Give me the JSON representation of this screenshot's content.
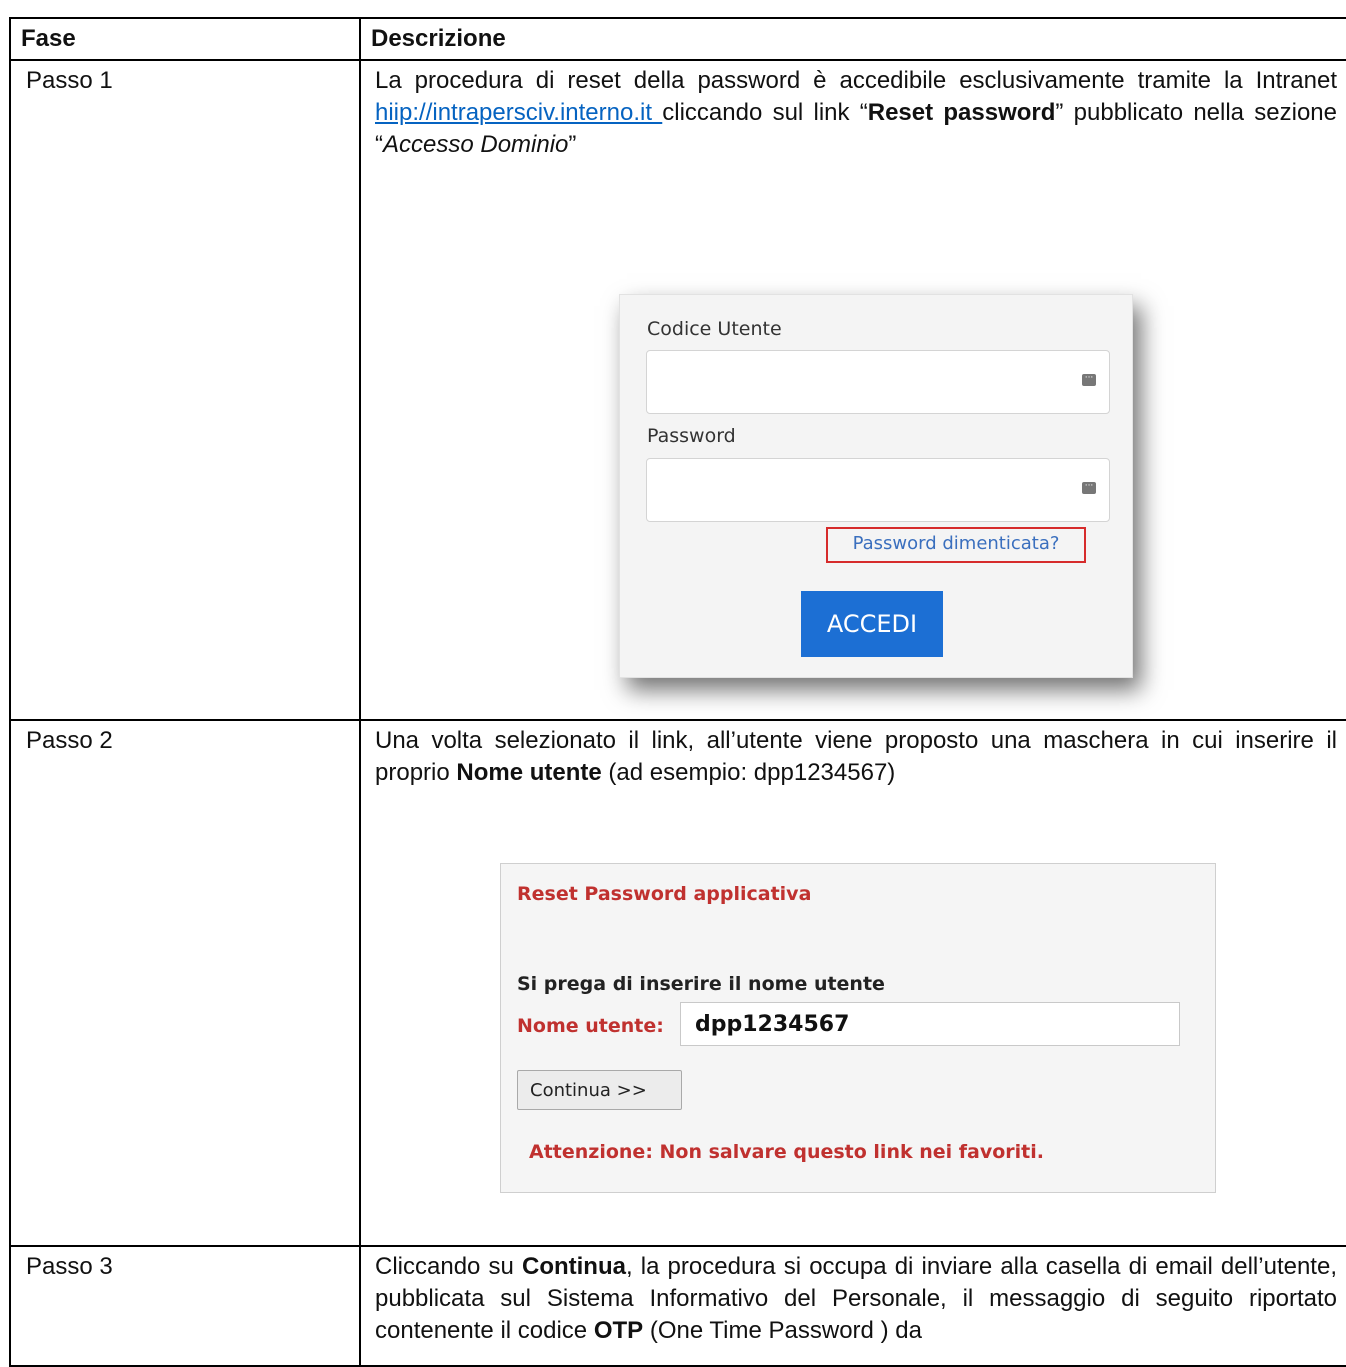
{
  "table": {
    "header": {
      "fase": "Fase",
      "descrizione": "Descrizione"
    }
  },
  "step1": {
    "label": "Passo 1",
    "text_1": "La procedura di reset della password è accedibile esclusivamente tramite la Intranet ",
    "link": "hiip://intrapersciv.interno.it ",
    "text_2": " cliccando sul link “",
    "bold": "Reset password",
    "text_3": "” pubblicato nella sezione “",
    "italic": "Accesso Dominio",
    "text_4": "”",
    "login": {
      "user_label": "Codice Utente",
      "password_label": "Password",
      "forgot_link": "Password dimenticata?",
      "submit": "ACCEDI",
      "key_icon": "key-icon"
    }
  },
  "step2": {
    "label": "Passo 2",
    "text_1": "Una volta selezionato il link, all’utente viene proposto una maschera in cui inserire il proprio ",
    "bold": "Nome utente",
    "text_2": " (ad esempio: dpp1234567)",
    "reset": {
      "title": "Reset Password applicativa",
      "subtitle": "Si prega di inserire il nome utente",
      "field_label": "Nome utente:",
      "field_value": "dpp1234567",
      "button": "Continua >>",
      "warning": "Attenzione: Non salvare questo link nei favoriti."
    }
  },
  "step3": {
    "label": "Passo 3",
    "text_1": "Cliccando su ",
    "bold_1": "Continua",
    "text_2": ", la procedura si occupa di inviare alla casella di email dell’utente, pubblicata sul Sistema Informativo del Personale, il messaggio di seguito riportato contenente il codice ",
    "bold_2": "OTP",
    "text_3": " (One Time Password ) da"
  },
  "colors": {
    "link": "#0563c1",
    "accent_red": "#c0312f",
    "button_blue": "#1c6fd4"
  }
}
